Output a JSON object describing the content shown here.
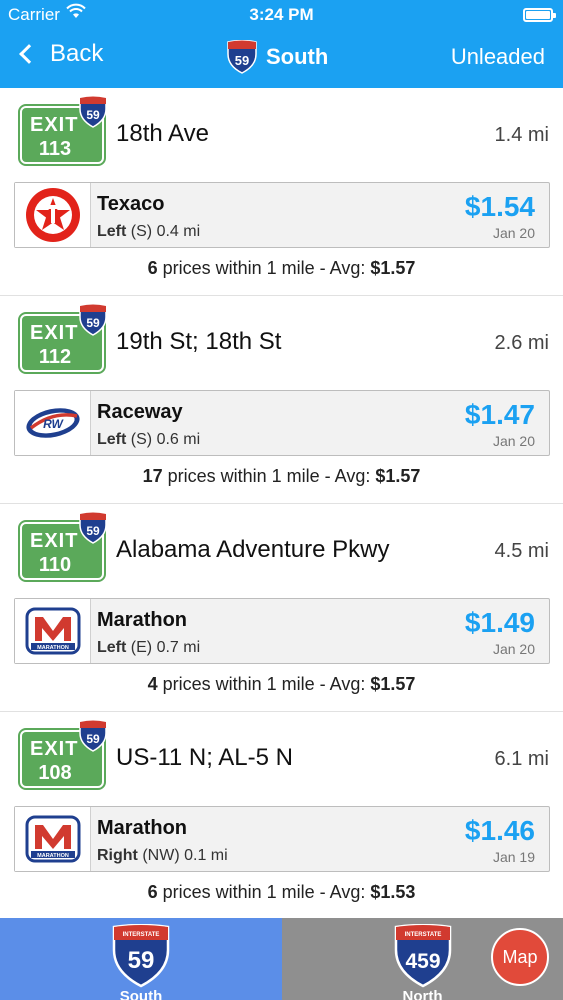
{
  "status": {
    "carrier": "Carrier",
    "time": "3:24 PM"
  },
  "nav": {
    "back_label": "Back",
    "route_number": "59",
    "direction": "South",
    "fuel_type": "Unleaded"
  },
  "colors": {
    "accent": "#1ba1f2",
    "exit_green": "#5ba95a",
    "shield_blue": "#1f3f8f",
    "shield_red": "#d13a2f",
    "tab_south": "#5b8ee8",
    "tab_north": "#8f8f8f",
    "map_button": "#e14a3a"
  },
  "exits": [
    {
      "exit_word": "EXIT",
      "number": "113",
      "route": "59",
      "name": "18th Ave",
      "distance": "1.4 mi",
      "station": {
        "brand": "Texaco",
        "logo": "texaco-logo",
        "side": "Left",
        "heading": "(S)",
        "distance": "0.4 mi",
        "price": "$1.54",
        "date": "Jan 20"
      },
      "summary": {
        "count": "6",
        "text": " prices within 1 mile - Avg: ",
        "avg": "$1.57"
      }
    },
    {
      "exit_word": "EXIT",
      "number": "112",
      "route": "59",
      "name": "19th St; 18th St",
      "distance": "2.6 mi",
      "station": {
        "brand": "Raceway",
        "logo": "raceway-logo",
        "side": "Left",
        "heading": "(S)",
        "distance": "0.6 mi",
        "price": "$1.47",
        "date": "Jan 20"
      },
      "summary": {
        "count": "17",
        "text": " prices within 1 mile - Avg: ",
        "avg": "$1.57"
      }
    },
    {
      "exit_word": "EXIT",
      "number": "110",
      "route": "59",
      "name": "Alabama Adventure Pkwy",
      "distance": "4.5 mi",
      "station": {
        "brand": "Marathon",
        "logo": "marathon-logo",
        "side": "Left",
        "heading": "(E)",
        "distance": "0.7 mi",
        "price": "$1.49",
        "date": "Jan 20"
      },
      "summary": {
        "count": "4",
        "text": " prices within 1 mile - Avg: ",
        "avg": "$1.57"
      }
    },
    {
      "exit_word": "EXIT",
      "number": "108",
      "route": "59",
      "name": "US-11 N; AL-5 N",
      "distance": "6.1 mi",
      "station": {
        "brand": "Marathon",
        "logo": "marathon-logo",
        "side": "Right",
        "heading": "(NW)",
        "distance": "0.1 mi",
        "price": "$1.46",
        "date": "Jan 19"
      },
      "summary": {
        "count": "6",
        "text": " prices within 1 mile - Avg: ",
        "avg": "$1.53"
      }
    }
  ],
  "tabs": {
    "south": {
      "shield_top": "INTERSTATE",
      "route": "59",
      "label": "South"
    },
    "north": {
      "shield_top": "INTERSTATE",
      "route": "459",
      "label": "North"
    },
    "map_label": "Map"
  }
}
